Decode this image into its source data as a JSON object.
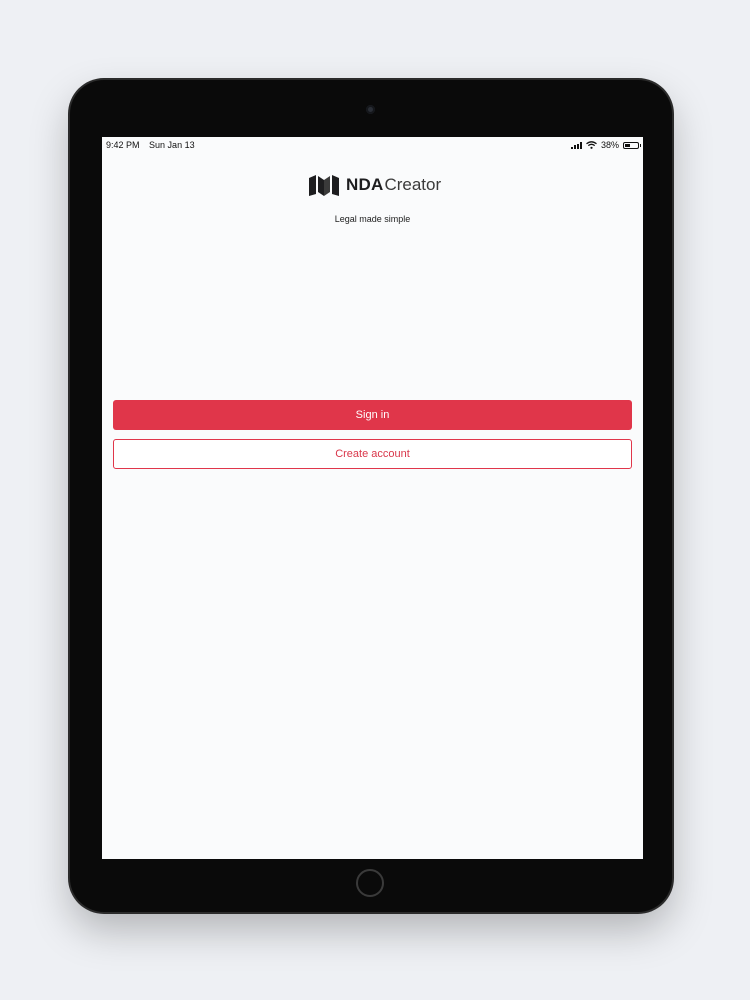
{
  "status_bar": {
    "time": "9:42 PM",
    "date": "Sun Jan 13",
    "battery_percent": "38%",
    "battery_level": 0.38,
    "icons": [
      "signal-icon",
      "wifi-icon",
      "battery-icon"
    ]
  },
  "app": {
    "logo_bold": "NDA",
    "logo_light": "Creator",
    "tagline": "Legal made simple"
  },
  "actions": {
    "sign_in_label": "Sign in",
    "create_account_label": "Create account"
  },
  "colors": {
    "accent": "#e0364a",
    "background": "#fafbfc",
    "device_frame": "#0a0a0a"
  }
}
